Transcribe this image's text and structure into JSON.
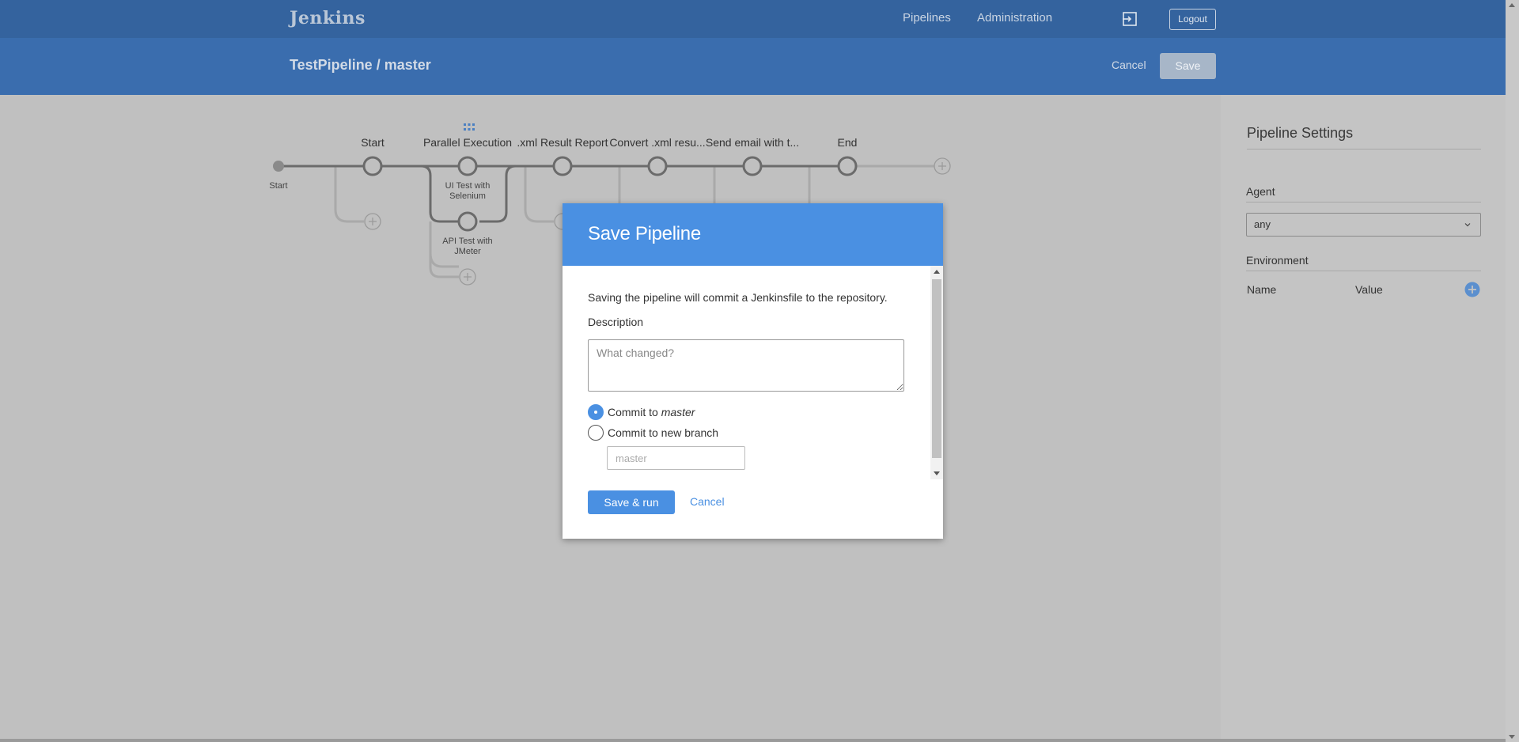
{
  "topnav": {
    "brand": "Jenkins",
    "links": {
      "pipelines": "Pipelines",
      "administration": "Administration"
    },
    "logout": "Logout"
  },
  "subheader": {
    "title": "TestPipeline / master",
    "cancel": "Cancel",
    "save": "Save"
  },
  "graph": {
    "start_label": "Start",
    "stages": [
      {
        "title": "Start"
      },
      {
        "title": "Parallel Execution"
      },
      {
        "title": ".xml Result Report"
      },
      {
        "title": "Convert .xml resu..."
      },
      {
        "title": "Send email with t..."
      },
      {
        "title": "End"
      }
    ],
    "parallel_branches": [
      {
        "label": "UI Test with Selenium"
      },
      {
        "label": "API Test with JMeter"
      }
    ]
  },
  "settings": {
    "title": "Pipeline Settings",
    "agent_label": "Agent",
    "agent_value": "any",
    "environment_label": "Environment",
    "env_name_header": "Name",
    "env_value_header": "Value"
  },
  "modal": {
    "title": "Save Pipeline",
    "message": "Saving the pipeline will commit a Jenkinsfile to the repository.",
    "description_label": "Description",
    "description_placeholder": "What changed?",
    "commit_to_prefix": "Commit to ",
    "commit_to_branch": "master",
    "commit_new_branch": "Commit to new branch",
    "branch_placeholder": "master",
    "save_run": "Save & run",
    "cancel": "Cancel"
  },
  "colors": {
    "topnav": "#34639e",
    "subheader": "#3a6dae",
    "accent": "#4a90e2",
    "overlay": "#c0c0c0"
  }
}
